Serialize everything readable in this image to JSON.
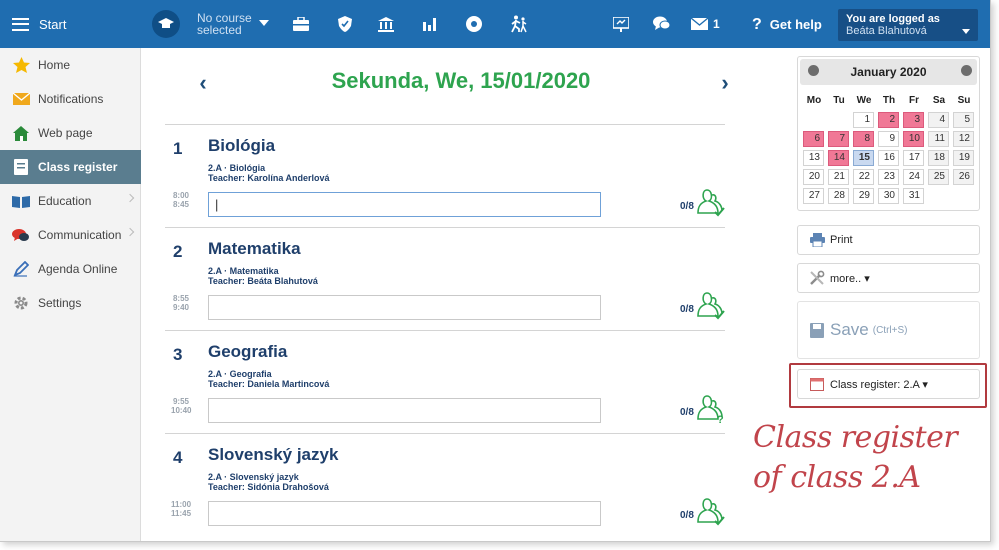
{
  "topbar": {
    "start_label": "Start",
    "course_line1": "No course",
    "course_line2": "selected",
    "mail_count": "1",
    "help_icon": "?",
    "help_label": "Get help",
    "login_line1": "You are logged as",
    "login_line2": "Beáta Blahutová",
    "icons": [
      "graduation-cap-icon",
      "briefcase-icon",
      "shield-icon",
      "institution-icon",
      "bar-chart-icon",
      "eye-icon",
      "running-person-icon",
      "presentation-icon",
      "chat-bubbles-icon",
      "mail-icon"
    ],
    "color": "#1f6db0"
  },
  "sidebar": {
    "items": [
      {
        "label": "Home",
        "icon": "star-icon"
      },
      {
        "label": "Notifications",
        "icon": "envelope-icon"
      },
      {
        "label": "Web page",
        "icon": "house-icon"
      },
      {
        "label": "Class register",
        "icon": "register-book-icon",
        "active": true
      },
      {
        "label": "Education",
        "icon": "open-book-icon"
      },
      {
        "label": "Communication",
        "icon": "speech-bubbles-icon"
      },
      {
        "label": "Agenda Online",
        "icon": "pen-icon"
      },
      {
        "label": "Settings",
        "icon": "gear-icon"
      }
    ]
  },
  "main": {
    "prev_arrow": "‹",
    "next_arrow": "›",
    "date_title": "Sekunda, We, 15/01/2020",
    "title_color": "#2ea44f",
    "lessons": [
      {
        "number": "1",
        "subject": "Biológia",
        "class_subject": "2.A · Biológia",
        "teacher_label": "Teacher:",
        "teacher": "Karolína Anderlová",
        "time_start": "8:00",
        "time_end": "8:45",
        "topic": "|",
        "attendance": "0/8",
        "attendance_mark": "check"
      },
      {
        "number": "2",
        "subject": "Matematika",
        "class_subject": "2.A · Matematika",
        "teacher_label": "Teacher:",
        "teacher": "Beáta Blahutová",
        "time_start": "8:55",
        "time_end": "9:40",
        "topic": "",
        "attendance": "0/8",
        "attendance_mark": "check"
      },
      {
        "number": "3",
        "subject": "Geografia",
        "class_subject": "2.A · Geografia",
        "teacher_label": "Teacher:",
        "teacher": "Daniela Martincová",
        "time_start": "9:55",
        "time_end": "10:40",
        "topic": "",
        "attendance": "0/8",
        "attendance_mark": "question"
      },
      {
        "number": "4",
        "subject": "Slovenský jazyk",
        "class_subject": "2.A · Slovenský jazyk",
        "teacher_label": "Teacher:",
        "teacher": "Sidónia Drahošová",
        "time_start": "11:00",
        "time_end": "11:45",
        "topic": "",
        "attendance": "0/8",
        "attendance_mark": "check"
      }
    ]
  },
  "calendar": {
    "month_label": "January 2020",
    "weekdays": [
      "Mo",
      "Tu",
      "We",
      "Th",
      "Fr",
      "Sa",
      "Su"
    ],
    "days": [
      {
        "d": "1",
        "type": ""
      },
      {
        "d": "2",
        "type": "hol"
      },
      {
        "d": "3",
        "type": "hol"
      },
      {
        "d": "4",
        "type": "we"
      },
      {
        "d": "5",
        "type": "we"
      },
      {
        "d": "6",
        "type": "hol"
      },
      {
        "d": "7",
        "type": "hol"
      },
      {
        "d": "8",
        "type": "hol"
      },
      {
        "d": "9",
        "type": ""
      },
      {
        "d": "10",
        "type": "hol"
      },
      {
        "d": "11",
        "type": "we"
      },
      {
        "d": "12",
        "type": "we"
      },
      {
        "d": "13",
        "type": ""
      },
      {
        "d": "14",
        "type": "hol"
      },
      {
        "d": "15",
        "type": "today"
      },
      {
        "d": "16",
        "type": ""
      },
      {
        "d": "17",
        "type": ""
      },
      {
        "d": "18",
        "type": "we"
      },
      {
        "d": "19",
        "type": "we"
      },
      {
        "d": "20",
        "type": ""
      },
      {
        "d": "21",
        "type": ""
      },
      {
        "d": "22",
        "type": ""
      },
      {
        "d": "23",
        "type": ""
      },
      {
        "d": "24",
        "type": ""
      },
      {
        "d": "25",
        "type": "we"
      },
      {
        "d": "26",
        "type": "we"
      },
      {
        "d": "27",
        "type": ""
      },
      {
        "d": "28",
        "type": ""
      },
      {
        "d": "29",
        "type": ""
      },
      {
        "d": "30",
        "type": ""
      },
      {
        "d": "31",
        "type": ""
      }
    ],
    "holiday_color": "#f07896"
  },
  "actions": {
    "print_label": "Print",
    "more_label": "more.. ▾",
    "save_label": "Save",
    "save_shortcut": "(Ctrl+S)",
    "class_register_label": "Class register: 2.A ▾"
  },
  "annotation": {
    "line1": "Class register",
    "line2": "of class 2.A",
    "color": "#c1444b"
  }
}
